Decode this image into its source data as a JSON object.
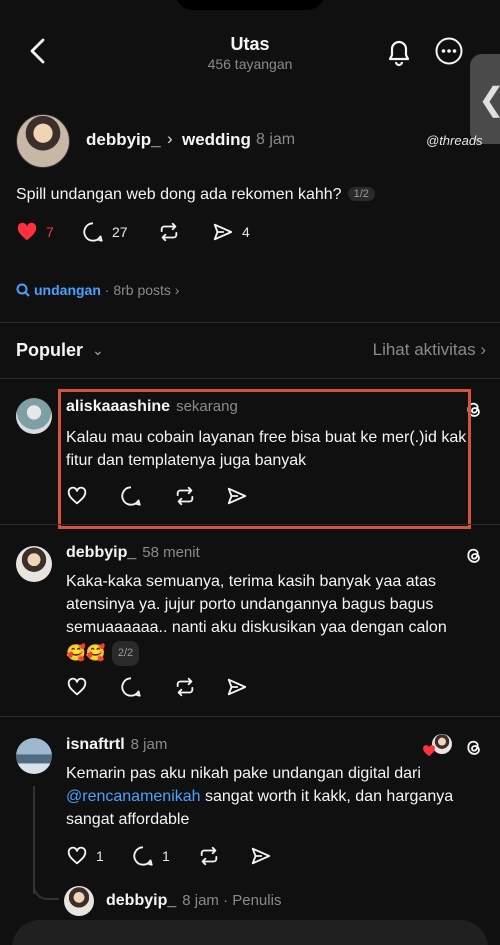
{
  "header": {
    "title": "Utas",
    "views": "456 tayangan"
  },
  "edge_tab_glyph": "❮",
  "op": {
    "username": "debbyip_",
    "topic": "wedding",
    "time": "8 jam",
    "brand": "@threads",
    "text": "Spill undangan web dong ada rekomen kahh?",
    "page": "1/2",
    "likes": "7",
    "comments": "27",
    "shares": "4"
  },
  "tag": {
    "name": "undangan",
    "meta": "· 8rb posts ›"
  },
  "sort": {
    "label": "Populer",
    "activity": "Lihat aktivitas ›"
  },
  "replies": [
    {
      "username": "aliskaaashine",
      "time": "sekarang",
      "text": "Kalau mau cobain layanan free bisa buat ke mer(.)id kak fitur dan templatenya juga banyak"
    },
    {
      "username": "debbyip_",
      "time": "58 menit",
      "text": "Kaka-kaka semuanya, terima kasih banyak yaa atas atensinya ya. jujur porto undangannya bagus bagus semuaaaaaa.. nanti aku diskusikan yaa dengan calon",
      "emoji": "🥰🥰",
      "page": "2/2"
    },
    {
      "username": "isnaftrtl",
      "time": "8 jam",
      "text_before": "Kemarin pas aku nikah pake undangan digital dari ",
      "mention": "@rencanamenikah",
      "text_after": " sangat worth it kakk, dan harganya sangat affordable",
      "likes": "1",
      "comments": "1"
    },
    {
      "username": "debbyip_",
      "time": "8 jam · Penulis"
    }
  ],
  "colors": {
    "background": "#101010",
    "like_red": "#ff3040",
    "link_blue": "#4aa1ff",
    "highlight": "#d5533b"
  }
}
